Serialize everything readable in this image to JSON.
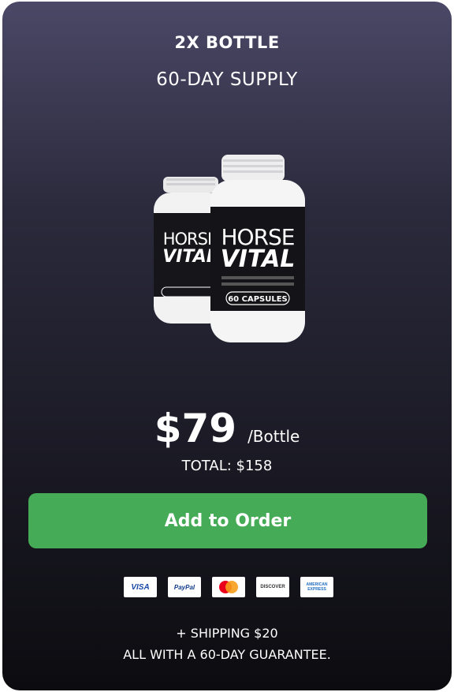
{
  "offer": {
    "title": "2X BOTTLE",
    "subtitle": "60-DAY SUPPLY",
    "price": "$79",
    "per_unit": "/Bottle",
    "total": "TOTAL: $158",
    "button_label": "Add to Order",
    "shipping": "+ SHIPPING $20",
    "guarantee": "ALL WITH A 60-DAY GUARANTEE."
  },
  "product": {
    "brand_line1": "HORSE",
    "brand_line2": "VITAL",
    "capsules": "60 CAPSULES",
    "bottle_count": 2
  },
  "payments": {
    "visa": "VISA",
    "paypal": "PayPal",
    "mastercard": "MasterCard",
    "discover": "DISCOVER",
    "amex_line1": "AMERICAN",
    "amex_line2": "EXPRESS"
  },
  "colors": {
    "button": "#45ab56",
    "card_top": "#4a4866",
    "card_bottom": "#0c0c10"
  }
}
